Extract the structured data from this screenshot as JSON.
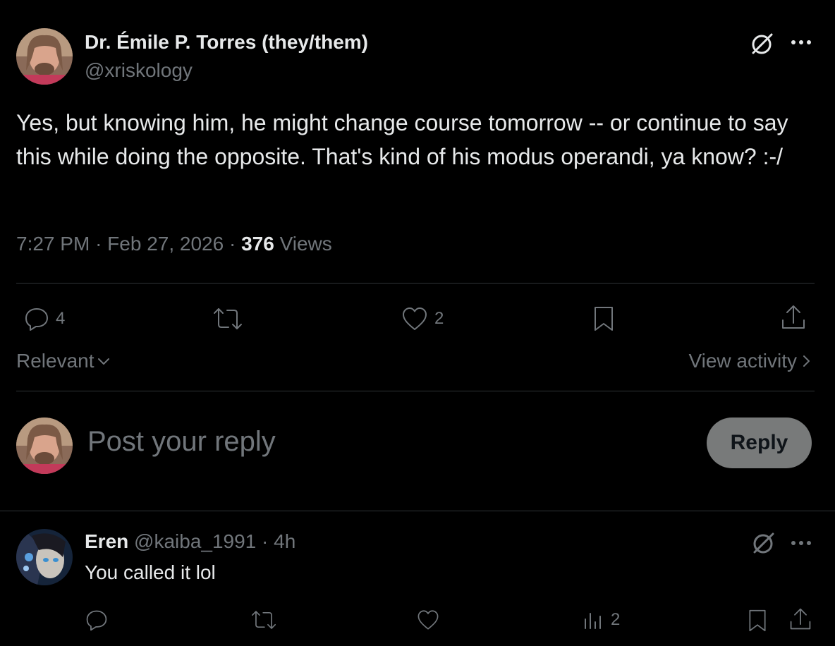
{
  "post": {
    "author_name": "Dr. Émile P. Torres (they/them)",
    "author_handle": "@xriskology",
    "text": "Yes, but knowing him, he might change course tomorrow -- or continue to say this while doing the opposite. That's kind of his modus operandi, ya know? :-/",
    "time": "7:27 PM",
    "date": "Feb 27, 2026",
    "views_count": "376",
    "views_label": "Views",
    "reply_count": "4",
    "like_count": "2"
  },
  "sort": {
    "label": "Relevant"
  },
  "activity": {
    "label": "View activity"
  },
  "composer": {
    "placeholder": "Post your reply",
    "reply_button": "Reply"
  },
  "reply": {
    "author_name": "Eren",
    "author_handle": "@kaiba_1991",
    "age": "4h",
    "text": "You called it lol",
    "view_count": "2"
  },
  "icons": {
    "grok": "grok-icon",
    "more": "more-icon",
    "reply": "reply-icon",
    "repost": "repost-icon",
    "like": "like-icon",
    "bookmark": "bookmark-icon",
    "share": "share-icon",
    "views": "views-icon"
  },
  "colors": {
    "background": "#000000",
    "text": "#e7e9ea",
    "muted": "#71767b",
    "divider": "#2f3336",
    "reply_button_bg": "#787a7a"
  }
}
